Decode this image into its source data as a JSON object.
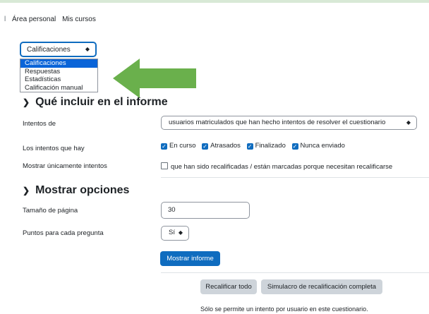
{
  "breadcrumb": {
    "separator": "l",
    "items": [
      "Área personal",
      "Mis cursos"
    ]
  },
  "report_select": {
    "value": "Calificaciones",
    "options": [
      "Calificaciones",
      "Respuestas",
      "Estadísticas",
      "Calificación manual"
    ],
    "selected_index": 0
  },
  "section_include": {
    "title": "Qué incluir en el informe",
    "attempts_from_label": "Intentos de",
    "attempts_from_value": "usuarios matriculados que han hecho intentos de resolver el cuestionario",
    "attempt_states_label": "Los intentos que hay",
    "attempt_states": [
      "En curso",
      "Atrasados",
      "Finalizado",
      "Nunca enviado"
    ],
    "only_attempts_label": "Mostrar únicamente intentos",
    "only_attempts_text": "que han sido recalificadas / están marcadas porque necesitan recalificarse"
  },
  "section_display": {
    "title": "Mostrar opciones",
    "page_size_label": "Tamaño de página",
    "page_size_value": "30",
    "marks_label": "Puntos para cada pregunta",
    "marks_value": "Sí",
    "show_report_button": "Mostrar informe"
  },
  "actions": {
    "regrade_all": "Recalificar todo",
    "dry_run": "Simulacro de recalificación completa"
  },
  "footer_note": "Sólo se permite un intento por usuario en este cuestionario.",
  "colors": {
    "primary": "#0f6cbf",
    "arrow": "#6ab04c",
    "selected": "#0a64d8"
  }
}
